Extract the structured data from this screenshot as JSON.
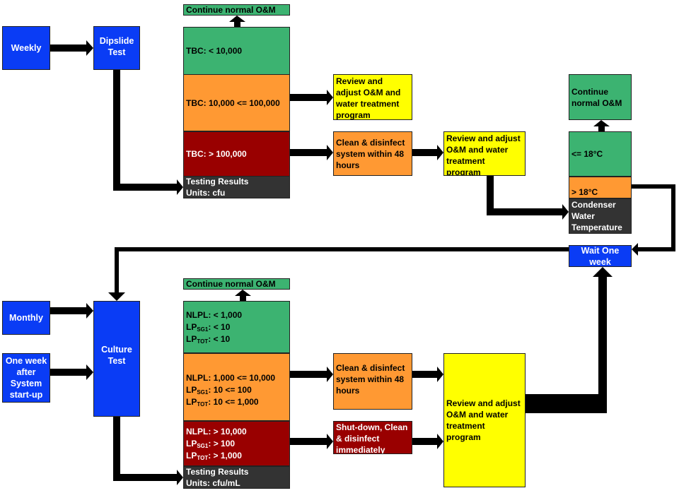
{
  "colors": {
    "blue": "#0a3cf5",
    "green": "#3cb371",
    "orange": "#ff9933",
    "red": "#990000",
    "dark": "#333333",
    "yellow": "#ffff00"
  },
  "top": {
    "weekly": "Weekly",
    "dipslide": [
      "Dipslide",
      "Test"
    ],
    "continue": "Continue normal O&M",
    "tbc_low": "TBC: < 10,000",
    "tbc_mid": "TBC: 10,000 <= 100,000",
    "tbc_high": "TBC: > 100,000",
    "results": [
      "Testing Results",
      "Units: cfu"
    ],
    "review": [
      "Review and",
      "adjust O&M and",
      "water treatment",
      "program"
    ],
    "clean": [
      "Clean & disinfect",
      "system within 48",
      "hours"
    ],
    "review2": [
      "Review and adjust",
      "O&M and water",
      "treatment",
      "program"
    ]
  },
  "temp": {
    "continue": [
      "Continue",
      "normal O&M"
    ],
    "low": "<= 18°C",
    "high": "> 18°C",
    "label": [
      "Condenser",
      "Water",
      "Temperature"
    ],
    "wait": [
      "Wait One",
      "week"
    ]
  },
  "bottom": {
    "monthly": "Monthly",
    "one_week": [
      "One week",
      "after",
      "System",
      "start-up"
    ],
    "culture": [
      "Culture",
      "Test"
    ],
    "continue": "Continue normal O&M",
    "low": [
      {
        "p": "NLPL",
        "s": "",
        "r": ": < 1,000"
      },
      {
        "p": "LP",
        "s": "SG1",
        "r": ": < 10"
      },
      {
        "p": "LP",
        "s": "TOT",
        "r": ": < 10"
      }
    ],
    "mid": [
      {
        "p": "NLPL",
        "s": "",
        "r": ": 1,000 <= 10,000"
      },
      {
        "p": "LP",
        "s": "SG1",
        "r": ": 10 <= 100"
      },
      {
        "p": "LP",
        "s": "TOT",
        "r": ": 10 <= 1,000"
      }
    ],
    "high": [
      {
        "p": "NLPL",
        "s": "",
        "r": ": > 10,000"
      },
      {
        "p": "LP",
        "s": "SG1",
        "r": ": > 100"
      },
      {
        "p": "LP",
        "s": "TOT",
        "r": ": > 1,000"
      }
    ],
    "results": [
      "Testing Results",
      "Units: cfu/mL"
    ],
    "clean": [
      "Clean & disinfect",
      "system within 48",
      "hours"
    ],
    "shutdown": [
      "Shut-down, Clean",
      "& disinfect",
      "immediately"
    ],
    "review": [
      "Review and adjust",
      "O&M and water",
      "treatment",
      "program"
    ]
  }
}
